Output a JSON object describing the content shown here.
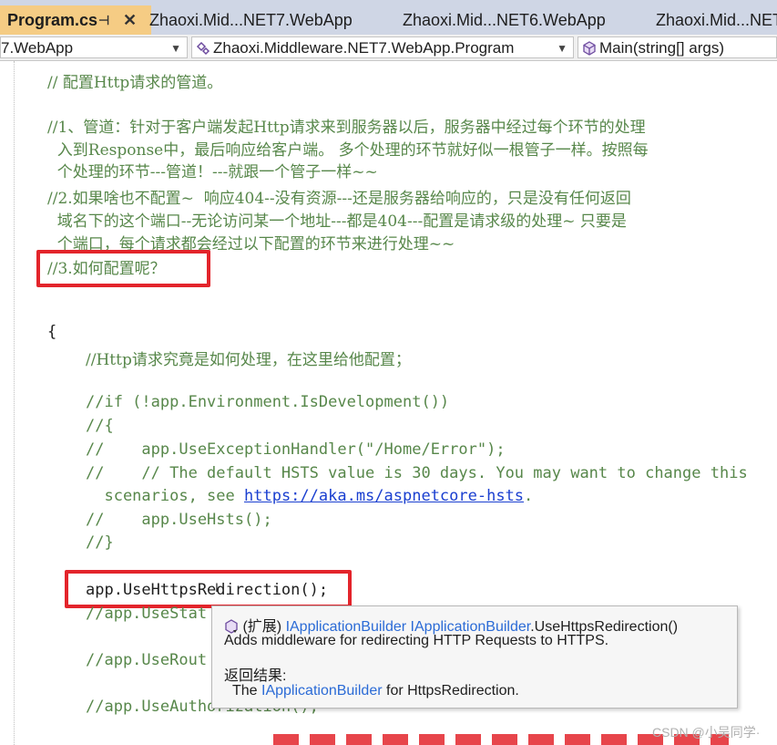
{
  "tabs": [
    {
      "label": "Program.cs",
      "active": true
    },
    {
      "label": "Zhaoxi.Mid...NET7.WebApp",
      "active": false
    },
    {
      "label": "Zhaoxi.Mid...NET6.WebApp",
      "active": false
    },
    {
      "label": "Zhaoxi.Mid...NET",
      "active": false
    }
  ],
  "tab_pin": "⊣",
  "tab_close": "✕",
  "nav": {
    "project": "7.WebApp",
    "class": "Zhaoxi.Middleware.NET7.WebApp.Program",
    "member": "Main(string[] args)"
  },
  "code": {
    "l0": "// 配置Http请求的管道。",
    "l1": "//1、管道：针对于客户端发起Http请求来到服务器以后，服务器中经过每个环节的处理",
    "l2": "  入到Response中，最后响应给客户端。 多个处理的环节就好似一根管子一样。按照每",
    "l3": "  个处理的环节---管道！---就跟一个管子一样~~",
    "l4": "//2.如果啥也不配置~  响应404--没有资源---还是服务器给响应的，只是没有任何返回",
    "l5": "  域名下的这个端口--无论访问某一个地址---都是404---配置是请求级的处理~ 只要是",
    "l6": "  个端口，每个请求都会经过以下配置的环节来进行处理~~",
    "l7": "//3.如何配置呢？",
    "brace": "{",
    "l8": "//Http请求究竟是如何处理，在这里给他配置；",
    "l9": "//if (!app.Environment.IsDevelopment())",
    "l10": "//{",
    "l11": "//    app.UseExceptionHandler(\"/Home/Error\");",
    "l12": "//    // The default HSTS value is 30 days. You may want to change this",
    "l13a": "  scenarios, see ",
    "l13link": "https://aka.ms/aspnetcore-hsts",
    "l13b": ".",
    "l14": "//    app.UseHsts();",
    "l15": "//}",
    "l16": "app.UseHttpsRedirection();",
    "l17": "//app.UseStat",
    "l18": "//app.UseRout",
    "l19": "//app.UseAuthorization();"
  },
  "tooltip": {
    "prefix": "(扩展) ",
    "type1": "IApplicationBuilder",
    "space": " ",
    "type2": "IApplicationBuilder",
    "method": ".UseHttpsRedirection()",
    "desc": "Adds middleware for redirecting HTTP Requests to HTTPS.",
    "returns_label": "返回结果:",
    "ret_pre": "The ",
    "ret_type": "IApplicationBuilder",
    "ret_post": " for HttpsRedirection."
  },
  "watermark": "CSDN @小吴同学·",
  "colors": {
    "comment": "#57874a",
    "highlight_box": "#e3242b",
    "active_tab": "#f5cc84",
    "type": "#2b6bd6"
  }
}
